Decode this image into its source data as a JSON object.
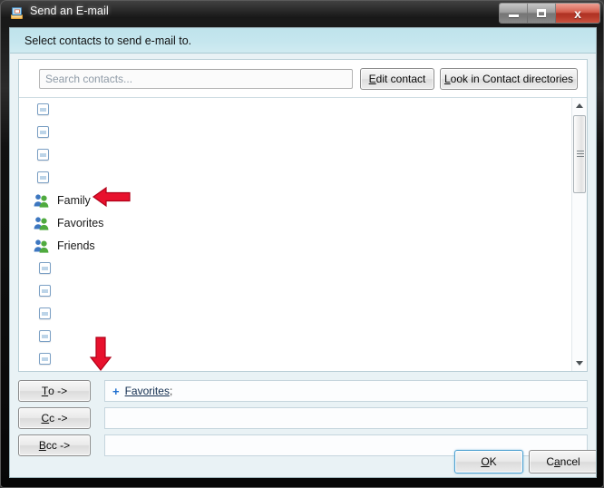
{
  "window": {
    "title": "Send an E-mail",
    "icon": "email-window-icon",
    "controls": [
      {
        "name": "minimize",
        "glyph": "minimize-icon"
      },
      {
        "name": "maximize",
        "glyph": "maximize-icon"
      },
      {
        "name": "close",
        "glyph": "close-icon",
        "label": "x"
      }
    ]
  },
  "banner": {
    "instruction": "Select contacts to send e-mail to."
  },
  "toolbar": {
    "search_placeholder": "Search contacts...",
    "search_value": "",
    "edit_contact": {
      "pre": "",
      "accel": "E",
      "post": "dit contact"
    },
    "look_in_directories": {
      "pre": "",
      "accel": "L",
      "post": "ook in Contact directories"
    }
  },
  "contact_list": {
    "rows": [
      {
        "type": "placeholder",
        "indent": 0
      },
      {
        "type": "placeholder",
        "indent": 0
      },
      {
        "type": "placeholder",
        "indent": 0
      },
      {
        "type": "placeholder",
        "indent": 0
      },
      {
        "type": "group",
        "label": "Family"
      },
      {
        "type": "group",
        "label": "Favorites"
      },
      {
        "type": "group",
        "label": "Friends"
      },
      {
        "type": "placeholder",
        "indent": 1
      },
      {
        "type": "placeholder",
        "indent": 1
      },
      {
        "type": "placeholder",
        "indent": 1
      },
      {
        "type": "placeholder",
        "indent": 1
      },
      {
        "type": "placeholder",
        "indent": 1
      },
      {
        "type": "placeholder",
        "indent": 1
      }
    ],
    "group_labels": {
      "family": "Family",
      "favorites": "Favorites",
      "friends": "Friends"
    }
  },
  "recipients": [
    {
      "button": {
        "accel": "T",
        "post": "o ->"
      },
      "field_name": "to-field",
      "entries": [
        {
          "plus": "+",
          "name": "Favorites",
          "separator": ";"
        }
      ]
    },
    {
      "button": {
        "accel": "C",
        "post": "c ->"
      },
      "field_name": "cc-field",
      "entries": []
    },
    {
      "button": {
        "accel": "B",
        "post": "cc ->"
      },
      "field_name": "bcc-field",
      "entries": []
    }
  ],
  "footer": {
    "ok": {
      "pre": "",
      "accel": "O",
      "post": "K"
    },
    "cancel": {
      "pre": "C",
      "accel": "a",
      "post": "ncel"
    }
  },
  "annotations": [
    {
      "name": "red-left-arrow",
      "points_to": "Favorites",
      "color": "#e8112d"
    },
    {
      "name": "red-down-arrow",
      "points_to": "to-field",
      "color": "#e8112d"
    }
  ],
  "colors": {
    "banner": "#c5e6ee",
    "client": "#e9f2f5",
    "annotation_red": "#e8112d",
    "link": "#122d4f",
    "plus": "#1f6fd0"
  }
}
